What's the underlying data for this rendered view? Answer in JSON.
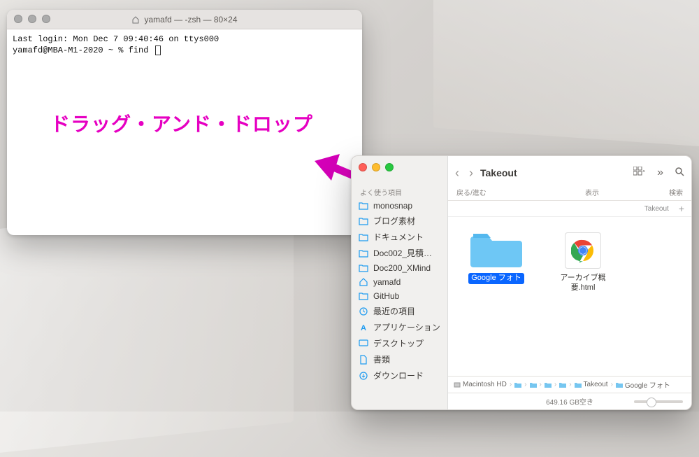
{
  "terminal": {
    "title": "yamafd — -zsh — 80×24",
    "line1": "Last login: Mon Dec  7 09:40:46 on ttys000",
    "prompt": "yamafd@MBA-M1-2020 ~ % find "
  },
  "annotation": "ドラッグ・アンド・ドロップ",
  "finder": {
    "title": "Takeout",
    "nav_back_label": "戻る/進む",
    "view_label": "表示",
    "search_label": "検索",
    "path_hint": "Takeout",
    "sidebar_header": "よく使う項目",
    "sidebar": [
      {
        "icon": "folder",
        "label": "monosnap"
      },
      {
        "icon": "folder",
        "label": "ブログ素材"
      },
      {
        "icon": "folder",
        "label": "ドキュメント"
      },
      {
        "icon": "folder",
        "label": "Doc002_見積…"
      },
      {
        "icon": "folder",
        "label": "Doc200_XMind"
      },
      {
        "icon": "home",
        "label": "yamafd"
      },
      {
        "icon": "folder",
        "label": "GitHub"
      },
      {
        "icon": "clock",
        "label": "最近の項目"
      },
      {
        "icon": "app",
        "label": "アプリケーション"
      },
      {
        "icon": "desktop",
        "label": "デスクトップ"
      },
      {
        "icon": "doc",
        "label": "書類"
      },
      {
        "icon": "download",
        "label": "ダウンロード"
      }
    ],
    "items": [
      {
        "kind": "folder",
        "label": "Google フォト",
        "selected": true
      },
      {
        "kind": "html",
        "label": "アーカイブ概要.html"
      }
    ],
    "pathbar": [
      "Macintosh HD",
      "",
      "",
      "",
      "",
      "Takeout",
      "Google フォト"
    ],
    "pathbar_disk": "Macintosh HD",
    "status": "649.16 GB空き"
  }
}
